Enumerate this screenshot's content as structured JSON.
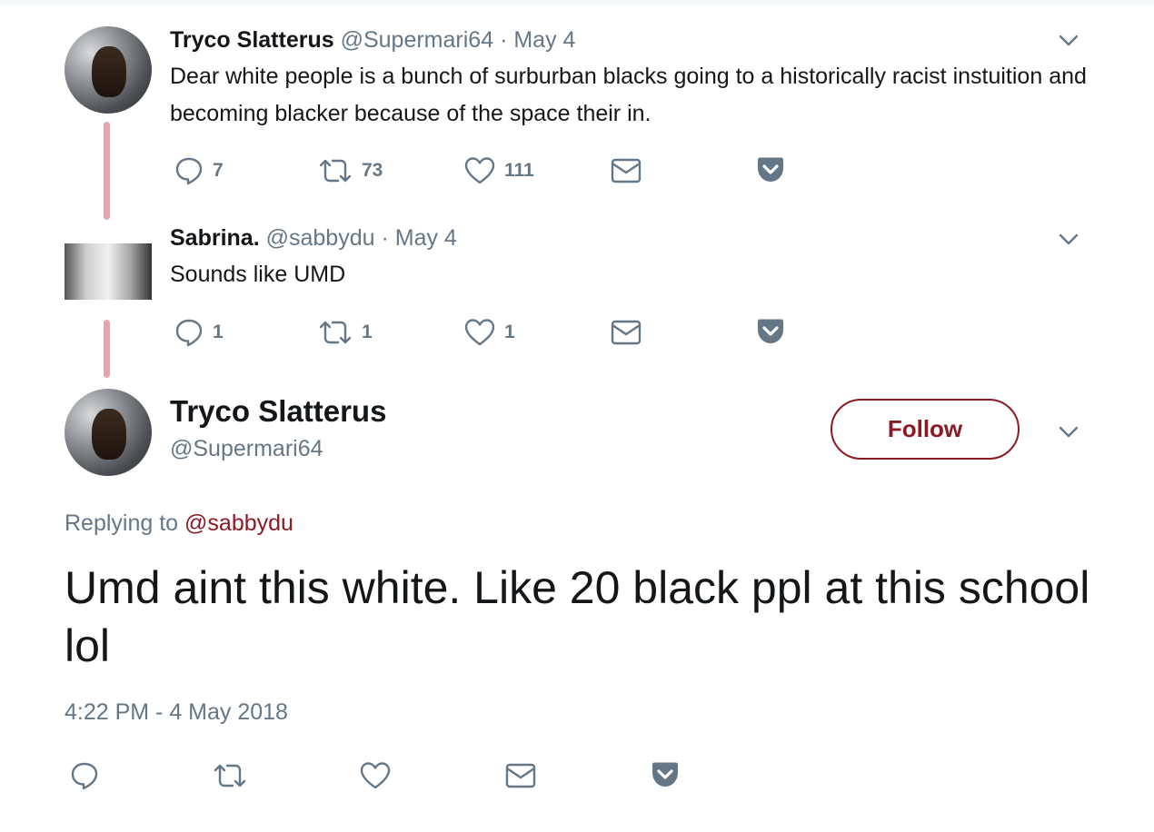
{
  "tweets": [
    {
      "name": "Tryco Slatterus",
      "handle": "@Supermari64",
      "sep": "·",
      "date": "May 4",
      "text": "Dear white people is a bunch of surburban blacks going to a historically racist instuition and becoming blacker because of the space their in.",
      "replies": "7",
      "retweets": "73",
      "likes": "111"
    },
    {
      "name": "Sabrina.",
      "handle": "@sabbydu",
      "sep": "·",
      "date": "May 4",
      "text": "Sounds like UMD",
      "replies": "1",
      "retweets": "1",
      "likes": "1"
    }
  ],
  "main_tweet": {
    "name": "Tryco Slatterus",
    "handle": "@Supermari64",
    "follow_label": "Follow",
    "replying_prefix": "Replying to",
    "replying_to": "@sabbydu",
    "text": "Umd aint this white. Like 20 black ppl at this school lol",
    "timestamp": "4:22 PM - 4 May 2018"
  },
  "colors": {
    "accent": "#8b1a24",
    "muted": "#657786",
    "thread_line": "#e0a8ae"
  },
  "icons": [
    "reply-icon",
    "retweet-icon",
    "like-icon",
    "dm-icon",
    "pocket-icon",
    "chevron-down-icon"
  ]
}
